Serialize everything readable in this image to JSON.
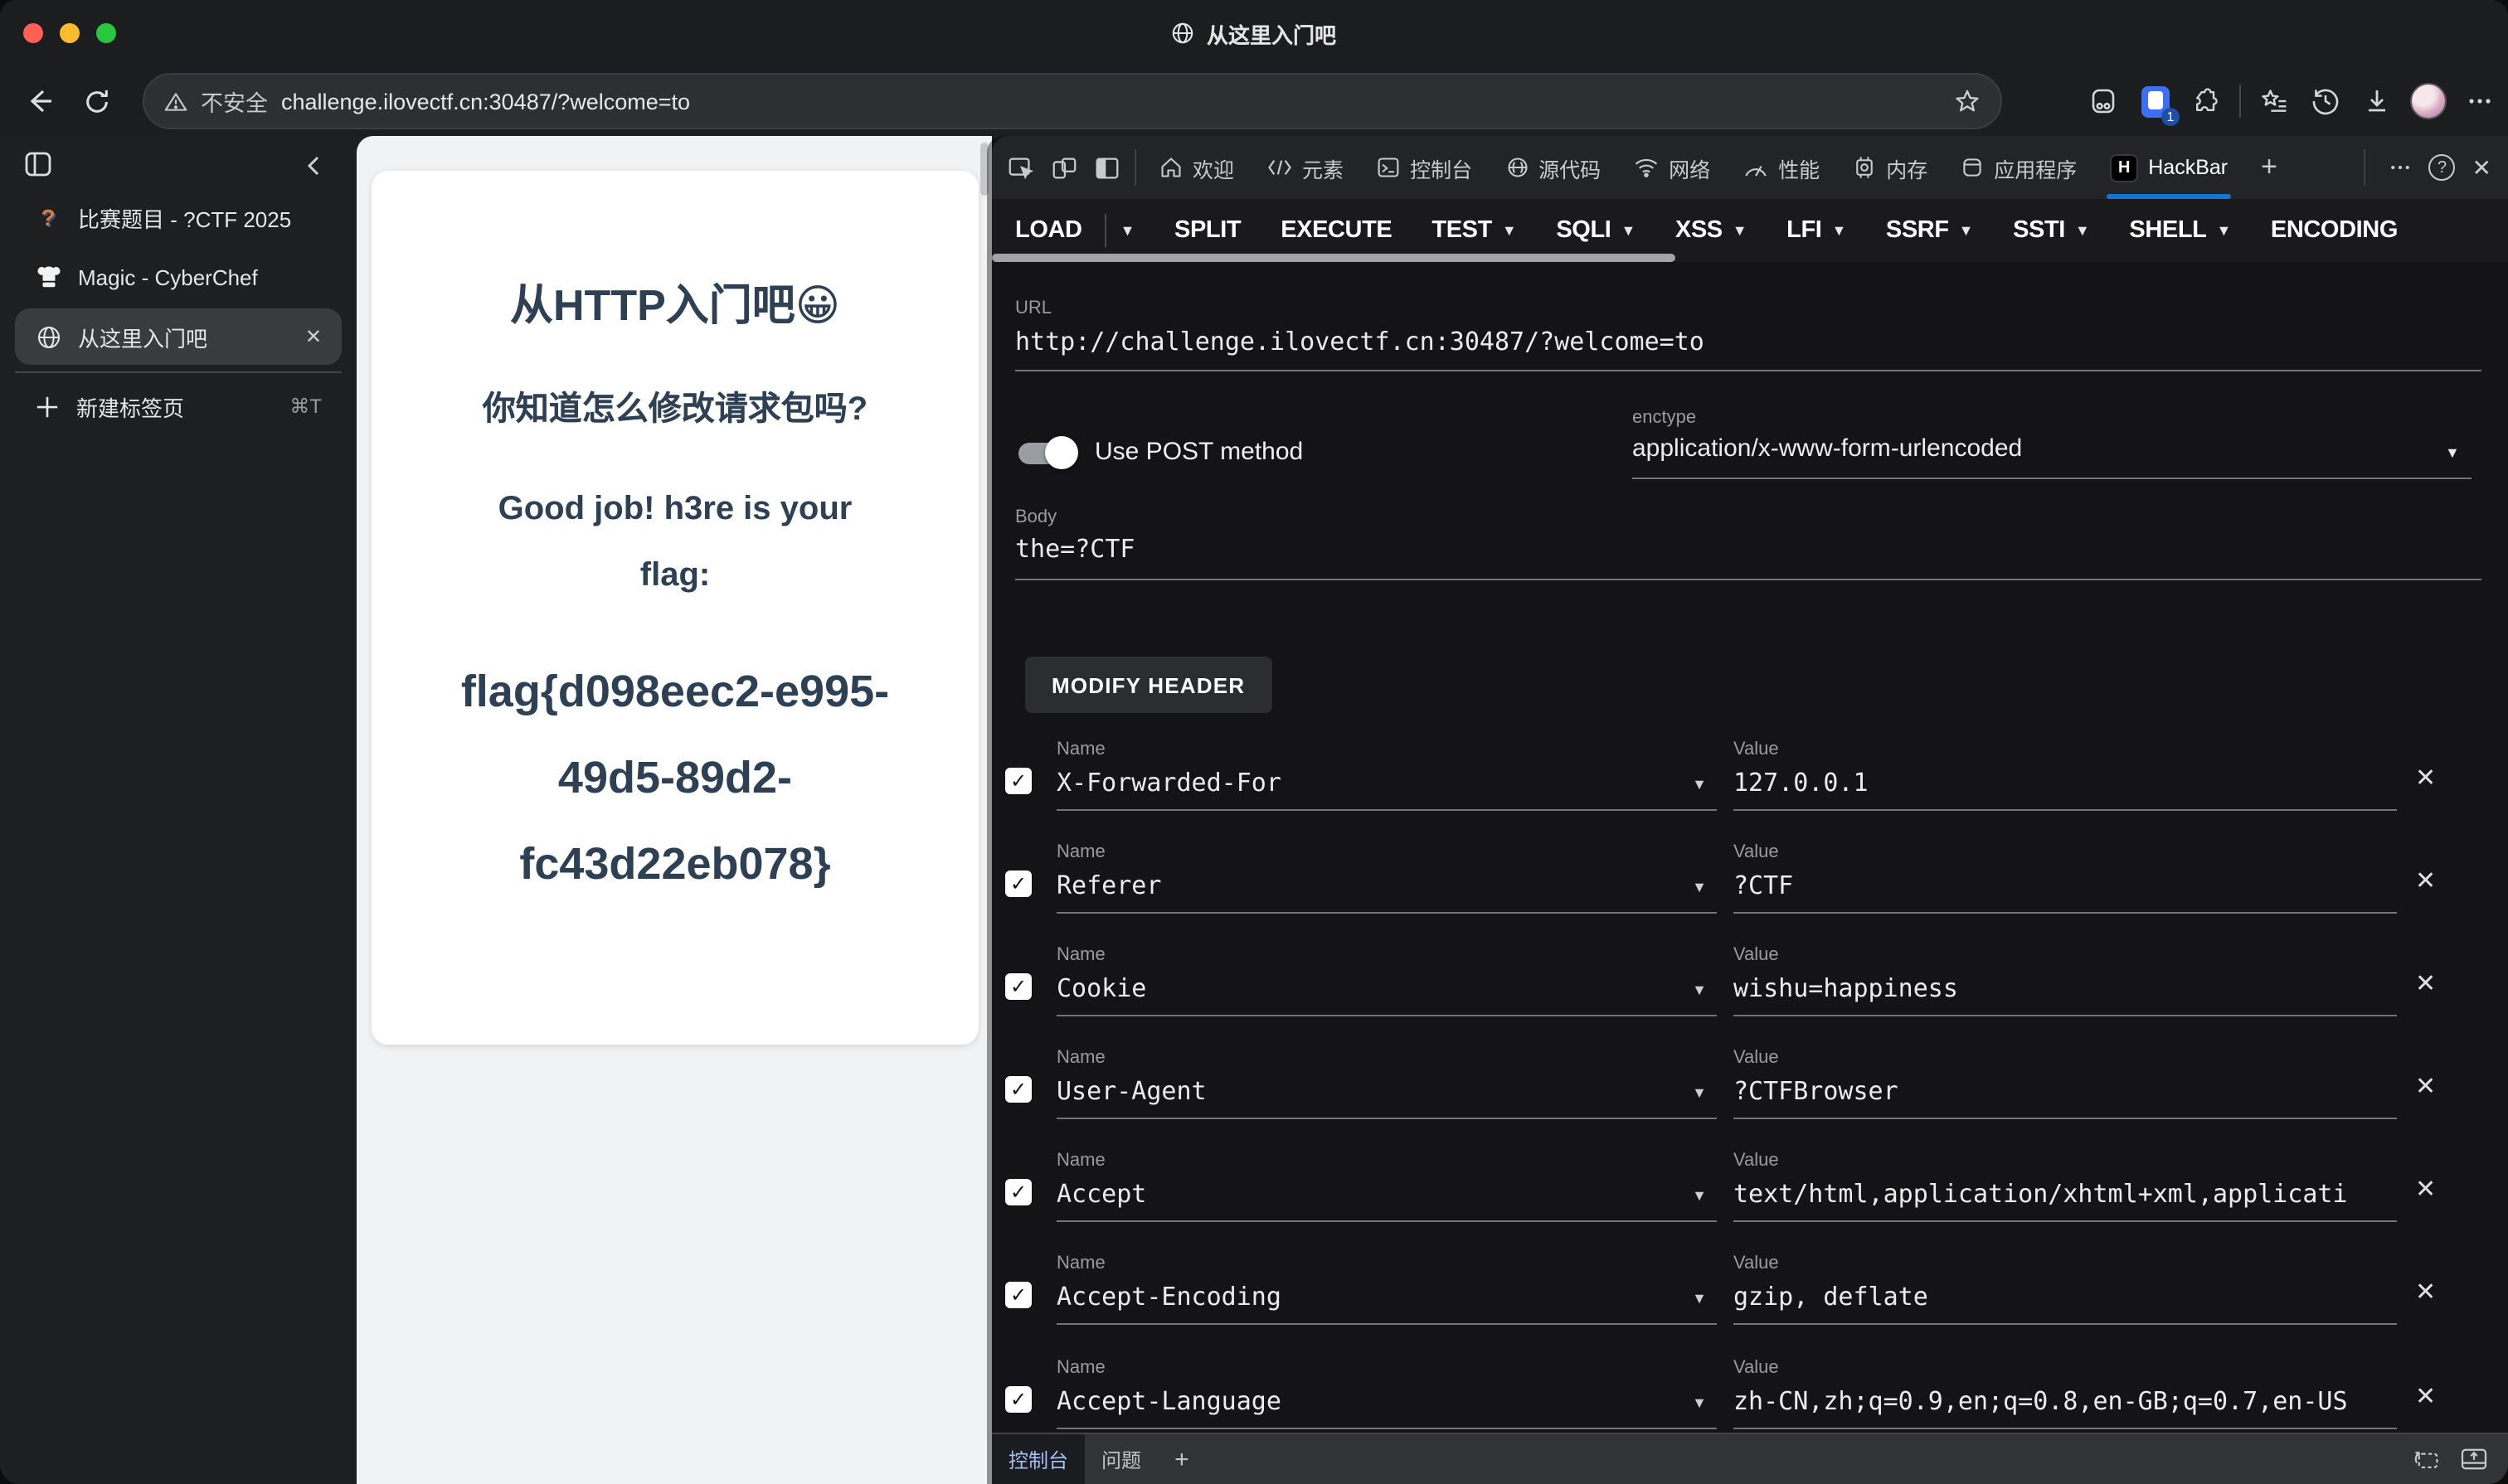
{
  "window": {
    "title": "从这里入门吧"
  },
  "toolbar": {
    "security_label": "不安全",
    "url": "challenge.ilovectf.cn:30487/?welcome=to",
    "extension_badge": "1"
  },
  "sidebar": {
    "tabs": [
      {
        "label": "比赛题目 - ?CTF 2025"
      },
      {
        "label": "Magic - CyberChef"
      },
      {
        "label": "从这里入门吧"
      }
    ],
    "new_tab_label": "新建标签页",
    "new_tab_shortcut": "⌘T"
  },
  "page": {
    "title": "从HTTP入门吧😀",
    "question": "你知道怎么修改请求包吗?",
    "message": "Good job! h3re is your flag:",
    "flag": "flag{d098eec2-e995-49d5-89d2-fc43d22eb078}"
  },
  "devtools": {
    "tabs": [
      {
        "label": "欢迎"
      },
      {
        "label": "元素"
      },
      {
        "label": "控制台"
      },
      {
        "label": "源代码"
      },
      {
        "label": "网络"
      },
      {
        "label": "性能"
      },
      {
        "label": "内存"
      },
      {
        "label": "应用程序"
      },
      {
        "label": "HackBar"
      }
    ],
    "hackbar_icon_letter": "H",
    "drawer": {
      "console_tab": "控制台",
      "issues_tab": "问题"
    }
  },
  "hackbar": {
    "menu": [
      {
        "label": "LOAD"
      },
      {
        "label": "SPLIT"
      },
      {
        "label": "EXECUTE"
      },
      {
        "label": "TEST"
      },
      {
        "label": "SQLI"
      },
      {
        "label": "XSS"
      },
      {
        "label": "LFI"
      },
      {
        "label": "SSRF"
      },
      {
        "label": "SSTI"
      },
      {
        "label": "SHELL"
      },
      {
        "label": "ENCODING"
      }
    ],
    "url_label": "URL",
    "url_value": "http://challenge.ilovectf.cn:30487/?welcome=to",
    "post_toggle_label": "Use POST method",
    "enctype_label": "enctype",
    "enctype_value": "application/x-www-form-urlencoded",
    "body_label": "Body",
    "body_value": "the=?CTF",
    "modify_header_label": "MODIFY HEADER",
    "name_label": "Name",
    "value_label": "Value",
    "headers": [
      {
        "name": "X-Forwarded-For",
        "value": "127.0.0.1"
      },
      {
        "name": "Referer",
        "value": "?CTF"
      },
      {
        "name": "Cookie",
        "value": "wishu=happiness"
      },
      {
        "name": "User-Agent",
        "value": "?CTFBrowser"
      },
      {
        "name": "Accept",
        "value": "text/html,application/xhtml+xml,applicati"
      },
      {
        "name": "Accept-Encoding",
        "value": "gzip, deflate"
      },
      {
        "name": "Accept-Language",
        "value": "zh-CN,zh;q=0.9,en;q=0.8,en-GB;q=0.7,en-US"
      }
    ]
  },
  "colors": {
    "accent_blue": "#1673d1",
    "page_text": "#2e4053",
    "traffic_red": "#ff5f57",
    "traffic_yellow": "#febc2e",
    "traffic_green": "#28c840"
  }
}
